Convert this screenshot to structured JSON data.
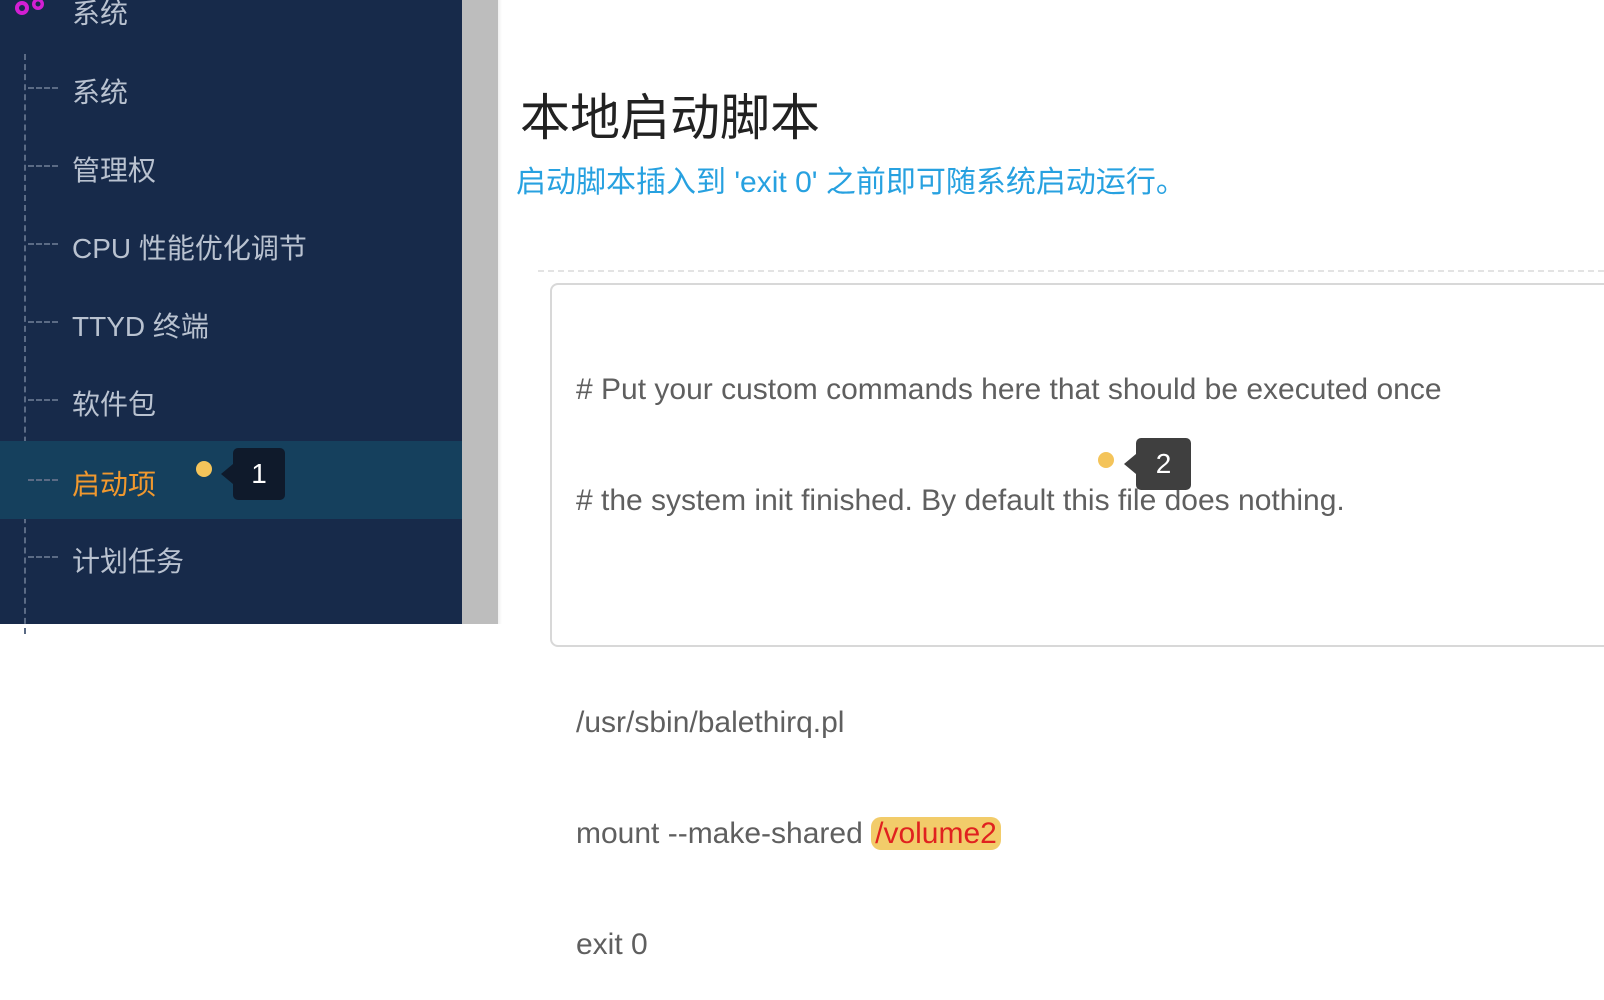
{
  "sidebar": {
    "top_label": "系统",
    "items": [
      {
        "label": "系统"
      },
      {
        "label": "管理权"
      },
      {
        "label": "CPU 性能优化调节"
      },
      {
        "label": "TTYD 终端"
      },
      {
        "label": "软件包"
      },
      {
        "label": "启动项"
      },
      {
        "label": "计划任务"
      }
    ],
    "active_index": 5
  },
  "main": {
    "title": "本地启动脚本",
    "description": "启动脚本插入到 'exit 0' 之前即可随系统启动运行。",
    "editor": {
      "lines": [
        "# Put your custom commands here that should be executed once",
        "# the system init finished. By default this file does nothing.",
        "",
        "/usr/sbin/balethirq.pl"
      ],
      "mount_prefix": "mount --make-shared ",
      "mount_target": "/volume2",
      "last_line": "exit 0"
    }
  },
  "annotations": [
    {
      "number": "1"
    },
    {
      "number": "2"
    }
  ],
  "colors": {
    "sidebar_bg": "#172a4a",
    "active_bg": "#15405d",
    "active_text": "#f0982e",
    "description": "#27a1e0",
    "highlight_bg": "#f2cc6a",
    "highlight_text": "#e0221f"
  }
}
